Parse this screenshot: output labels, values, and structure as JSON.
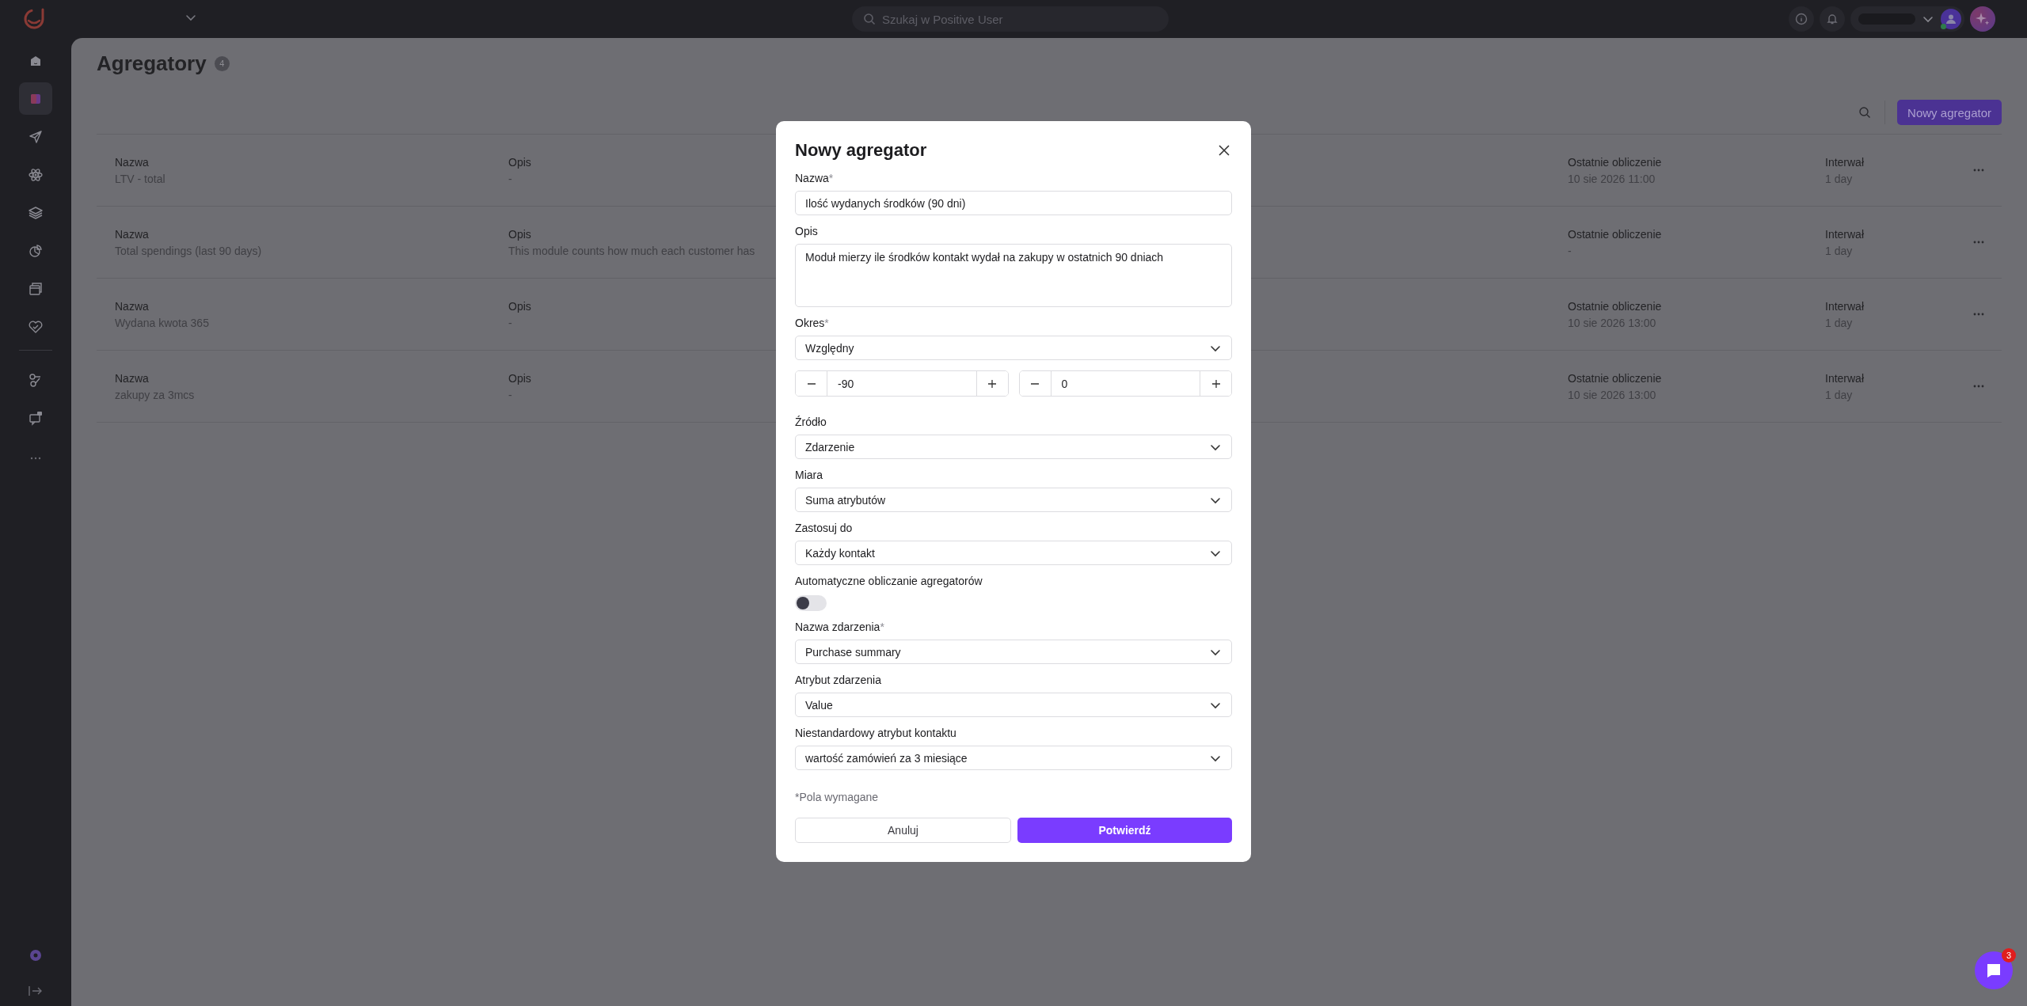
{
  "topbar": {
    "search_placeholder": "Szukaj w Positive User"
  },
  "sidebar": {
    "items": [
      {
        "selected": false
      },
      {
        "selected": true
      },
      {
        "selected": false
      },
      {
        "selected": false
      },
      {
        "selected": false
      },
      {
        "selected": false
      },
      {
        "selected": false
      },
      {
        "selected": false
      }
    ],
    "tools": [
      {
        "selected": false
      },
      {
        "selected": false
      }
    ]
  },
  "page": {
    "title": "Agregatory",
    "count": "4",
    "new_button": "Nowy agregator"
  },
  "table": {
    "rows": [
      {
        "cells": [
          {
            "label": "Nazwa",
            "value": "LTV - total"
          },
          {
            "label": "Opis",
            "value": "-"
          },
          {
            "label": "Ostatnie obliczenie",
            "value": "10 sie 2026 11:00"
          },
          {
            "label": "Interwał",
            "value": "1 day"
          }
        ]
      },
      {
        "cells": [
          {
            "label": "Nazwa",
            "value": "Total spendings (last 90 days)"
          },
          {
            "label": "Opis",
            "value": "This module counts how much each customer has"
          },
          {
            "label": "Ostatnie obliczenie",
            "value": "-"
          },
          {
            "label": "Interwał",
            "value": "1 day"
          }
        ]
      },
      {
        "cells": [
          {
            "label": "Nazwa",
            "value": "Wydana kwota 365"
          },
          {
            "label": "Opis",
            "value": "-"
          },
          {
            "label": "Ostatnie obliczenie",
            "value": "10 sie 2026 13:00"
          },
          {
            "label": "Interwał",
            "value": "1 day"
          }
        ]
      },
      {
        "cells": [
          {
            "label": "Nazwa",
            "value": "zakupy za 3mcs"
          },
          {
            "label": "Opis",
            "value": "-"
          },
          {
            "label": "Ostatnie obliczenie",
            "value": "10 sie 2026 13:00"
          },
          {
            "label": "Interwał",
            "value": "1 day"
          }
        ]
      }
    ]
  },
  "modal": {
    "title": "Nowy agregator",
    "required_mark": "*",
    "fields": [
      {
        "kind": "text",
        "label": "Nazwa",
        "required": true,
        "value": "Ilość wydanych środków (90 dni)"
      },
      {
        "kind": "textarea",
        "label": "Opis",
        "required": false,
        "value": "Moduł mierzy ile środków kontakt wydał na zakupy w ostatnich 90 dniach"
      },
      {
        "kind": "select",
        "label": "Okres",
        "required": true,
        "value": "Względny"
      },
      {
        "kind": "steppers",
        "steppers": [
          {
            "value": "-90"
          },
          {
            "value": "0"
          }
        ]
      },
      {
        "kind": "select",
        "label": "Źródło",
        "required": false,
        "value": "Zdarzenie"
      },
      {
        "kind": "select",
        "label": "Miara",
        "required": false,
        "value": "Suma atrybutów"
      },
      {
        "kind": "select",
        "label": "Zastosuj do",
        "required": false,
        "value": "Każdy kontakt"
      },
      {
        "kind": "toggle",
        "label": "Automatyczne obliczanie agregatorów",
        "required": false,
        "on": false
      },
      {
        "kind": "select",
        "label": "Nazwa zdarzenia",
        "required": true,
        "value": "Purchase summary"
      },
      {
        "kind": "select",
        "label": "Atrybut zdarzenia",
        "required": false,
        "value": "Value"
      },
      {
        "kind": "select",
        "label": "Niestandardowy atrybut kontaktu",
        "required": false,
        "value": "wartość zamówień za 3 miesiące"
      }
    ],
    "required_note": "*Pola wymagane",
    "buttons": [
      {
        "label": "Anuluj",
        "kind": "secondary"
      },
      {
        "label": "Potwierdź",
        "kind": "primary"
      }
    ]
  },
  "chat": {
    "badge": "3"
  }
}
